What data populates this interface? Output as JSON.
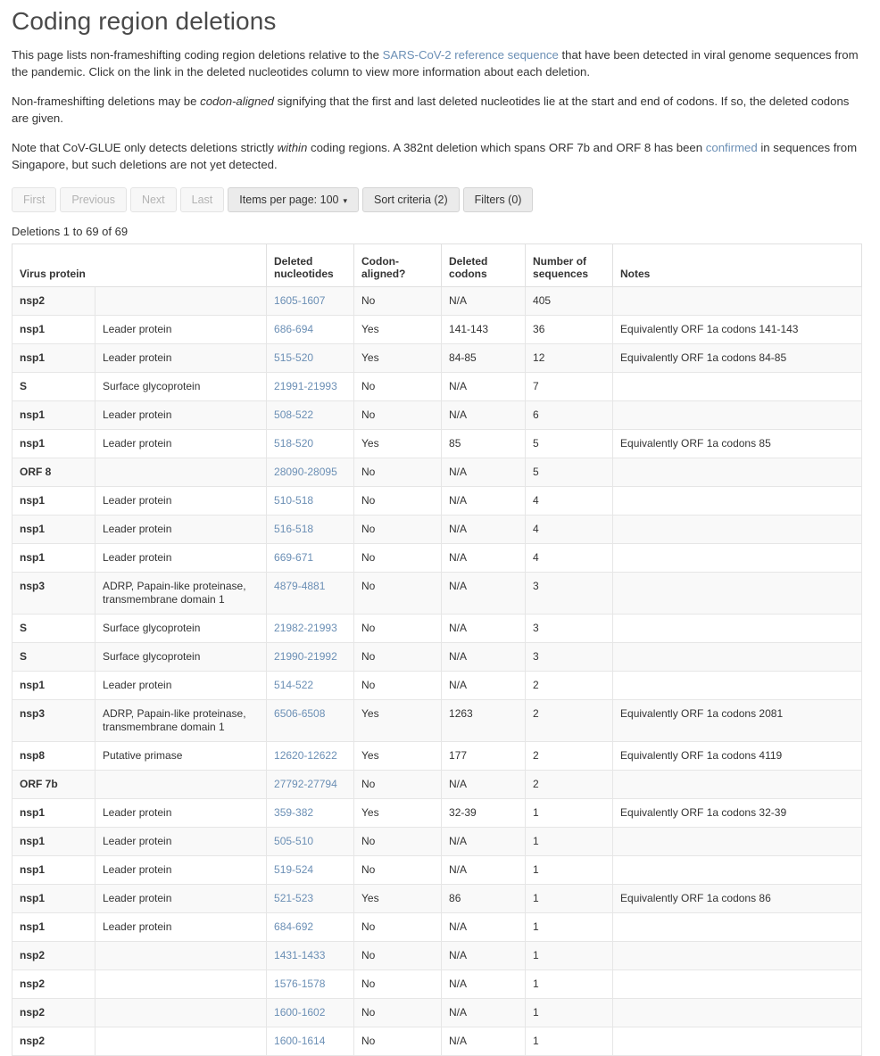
{
  "page": {
    "title": "Coding region deletions",
    "paragraphs": [
      {
        "id": "p1",
        "parts": [
          {
            "type": "text",
            "text": "This page lists non-frameshifting coding region deletions relative to the "
          },
          {
            "type": "link",
            "text": "SARS-CoV-2 reference sequence"
          },
          {
            "type": "text",
            "text": " that have been detected in viral genome sequences from the pandemic. Click on the link in the deleted nucleotides column to view more information about each deletion."
          }
        ]
      },
      {
        "id": "p2",
        "parts": [
          {
            "type": "text",
            "text": "Non-frameshifting deletions may be "
          },
          {
            "type": "em",
            "text": "codon-aligned"
          },
          {
            "type": "text",
            "text": " signifying that the first and last deleted nucleotides lie at the start and end of codons. If so, the deleted codons are given."
          }
        ]
      },
      {
        "id": "p3",
        "parts": [
          {
            "type": "text",
            "text": "Note that CoV-GLUE only detects deletions strictly "
          },
          {
            "type": "em",
            "text": "within"
          },
          {
            "type": "text",
            "text": " coding regions. A 382nt deletion which spans ORF 7b and ORF 8 has been "
          },
          {
            "type": "link",
            "text": "confirmed"
          },
          {
            "type": "text",
            "text": " in sequences from Singapore, but such deletions are not yet detected."
          }
        ]
      }
    ]
  },
  "intro_text": {
    "p1_a": "This page lists non-frameshifting coding region deletions relative to the ",
    "p1_link": "SARS-CoV-2 reference sequence",
    "p1_b": " that have been detected in viral genome sequences from the pandemic. Click on the link in the deleted nucleotides column to view more information about each deletion.",
    "p2_a": "Non-frameshifting deletions may be ",
    "p2_em": "codon-aligned",
    "p2_b": " signifying that the first and last deleted nucleotides lie at the start and end of codons. If so, the deleted codons are given.",
    "p3_a": "Note that CoV-GLUE only detects deletions strictly ",
    "p3_em": "within",
    "p3_b": " coding regions. A 382nt deletion which spans ORF 7b and ORF 8 has been ",
    "p3_link": "confirmed",
    "p3_c": " in sequences from Singapore, but such deletions are not yet detected."
  },
  "toolbar": {
    "first": "First",
    "previous": "Previous",
    "next": "Next",
    "last": "Last",
    "items_per_page": "Items per page: 100",
    "caret": "▾",
    "sort_criteria": "Sort criteria (2)",
    "filters": "Filters (0)",
    "disabled": [
      "First",
      "Previous",
      "Next",
      "Last"
    ]
  },
  "result_count": "Deletions 1 to 69 of 69",
  "table": {
    "headers": {
      "virus_protein": "Virus protein",
      "protein_description": "",
      "deleted_nucleotides": "Deleted nucleotides",
      "codon_aligned": "Codon-aligned?",
      "deleted_codons": "Deleted codons",
      "number_of_sequences": "Number of sequences",
      "notes": "Notes"
    },
    "rows": [
      {
        "protein": "nsp2",
        "description": "",
        "nucleotides": "1605-1607",
        "codon_aligned": "No",
        "codons": "N/A",
        "sequences": "405",
        "notes": ""
      },
      {
        "protein": "nsp1",
        "description": "Leader protein",
        "nucleotides": "686-694",
        "codon_aligned": "Yes",
        "codons": "141-143",
        "sequences": "36",
        "notes": "Equivalently ORF 1a codons 141-143"
      },
      {
        "protein": "nsp1",
        "description": "Leader protein",
        "nucleotides": "515-520",
        "codon_aligned": "Yes",
        "codons": "84-85",
        "sequences": "12",
        "notes": "Equivalently ORF 1a codons 84-85"
      },
      {
        "protein": "S",
        "description": "Surface glycoprotein",
        "nucleotides": "21991-21993",
        "codon_aligned": "No",
        "codons": "N/A",
        "sequences": "7",
        "notes": ""
      },
      {
        "protein": "nsp1",
        "description": "Leader protein",
        "nucleotides": "508-522",
        "codon_aligned": "No",
        "codons": "N/A",
        "sequences": "6",
        "notes": ""
      },
      {
        "protein": "nsp1",
        "description": "Leader protein",
        "nucleotides": "518-520",
        "codon_aligned": "Yes",
        "codons": "85",
        "sequences": "5",
        "notes": "Equivalently ORF 1a codons 85"
      },
      {
        "protein": "ORF 8",
        "description": "",
        "nucleotides": "28090-28095",
        "codon_aligned": "No",
        "codons": "N/A",
        "sequences": "5",
        "notes": ""
      },
      {
        "protein": "nsp1",
        "description": "Leader protein",
        "nucleotides": "510-518",
        "codon_aligned": "No",
        "codons": "N/A",
        "sequences": "4",
        "notes": ""
      },
      {
        "protein": "nsp1",
        "description": "Leader protein",
        "nucleotides": "516-518",
        "codon_aligned": "No",
        "codons": "N/A",
        "sequences": "4",
        "notes": ""
      },
      {
        "protein": "nsp1",
        "description": "Leader protein",
        "nucleotides": "669-671",
        "codon_aligned": "No",
        "codons": "N/A",
        "sequences": "4",
        "notes": ""
      },
      {
        "protein": "nsp3",
        "description": "ADRP, Papain-like proteinase, transmembrane domain 1",
        "nucleotides": "4879-4881",
        "codon_aligned": "No",
        "codons": "N/A",
        "sequences": "3",
        "notes": ""
      },
      {
        "protein": "S",
        "description": "Surface glycoprotein",
        "nucleotides": "21982-21993",
        "codon_aligned": "No",
        "codons": "N/A",
        "sequences": "3",
        "notes": ""
      },
      {
        "protein": "S",
        "description": "Surface glycoprotein",
        "nucleotides": "21990-21992",
        "codon_aligned": "No",
        "codons": "N/A",
        "sequences": "3",
        "notes": ""
      },
      {
        "protein": "nsp1",
        "description": "Leader protein",
        "nucleotides": "514-522",
        "codon_aligned": "No",
        "codons": "N/A",
        "sequences": "2",
        "notes": ""
      },
      {
        "protein": "nsp3",
        "description": "ADRP, Papain-like proteinase, transmembrane domain 1",
        "nucleotides": "6506-6508",
        "codon_aligned": "Yes",
        "codons": "1263",
        "sequences": "2",
        "notes": "Equivalently ORF 1a codons 2081"
      },
      {
        "protein": "nsp8",
        "description": "Putative primase",
        "nucleotides": "12620-12622",
        "codon_aligned": "Yes",
        "codons": "177",
        "sequences": "2",
        "notes": "Equivalently ORF 1a codons 4119"
      },
      {
        "protein": "ORF 7b",
        "description": "",
        "nucleotides": "27792-27794",
        "codon_aligned": "No",
        "codons": "N/A",
        "sequences": "2",
        "notes": ""
      },
      {
        "protein": "nsp1",
        "description": "Leader protein",
        "nucleotides": "359-382",
        "codon_aligned": "Yes",
        "codons": "32-39",
        "sequences": "1",
        "notes": "Equivalently ORF 1a codons 32-39"
      },
      {
        "protein": "nsp1",
        "description": "Leader protein",
        "nucleotides": "505-510",
        "codon_aligned": "No",
        "codons": "N/A",
        "sequences": "1",
        "notes": ""
      },
      {
        "protein": "nsp1",
        "description": "Leader protein",
        "nucleotides": "519-524",
        "codon_aligned": "No",
        "codons": "N/A",
        "sequences": "1",
        "notes": ""
      },
      {
        "protein": "nsp1",
        "description": "Leader protein",
        "nucleotides": "521-523",
        "codon_aligned": "Yes",
        "codons": "86",
        "sequences": "1",
        "notes": "Equivalently ORF 1a codons 86"
      },
      {
        "protein": "nsp1",
        "description": "Leader protein",
        "nucleotides": "684-692",
        "codon_aligned": "No",
        "codons": "N/A",
        "sequences": "1",
        "notes": ""
      },
      {
        "protein": "nsp2",
        "description": "",
        "nucleotides": "1431-1433",
        "codon_aligned": "No",
        "codons": "N/A",
        "sequences": "1",
        "notes": ""
      },
      {
        "protein": "nsp2",
        "description": "",
        "nucleotides": "1576-1578",
        "codon_aligned": "No",
        "codons": "N/A",
        "sequences": "1",
        "notes": ""
      },
      {
        "protein": "nsp2",
        "description": "",
        "nucleotides": "1600-1602",
        "codon_aligned": "No",
        "codons": "N/A",
        "sequences": "1",
        "notes": ""
      },
      {
        "protein": "nsp2",
        "description": "",
        "nucleotides": "1600-1614",
        "codon_aligned": "No",
        "codons": "N/A",
        "sequences": "1",
        "notes": ""
      }
    ]
  },
  "colors": {
    "link": "#6b8fb5",
    "title": "#4a4a4a",
    "text": "#333333",
    "border": "#e0e0e0",
    "stripe": "#f9f9f9",
    "button_bg": "#f4f4f4",
    "button_strong_bg": "#ebebeb",
    "button_disabled_text": "#b3b3b3"
  }
}
